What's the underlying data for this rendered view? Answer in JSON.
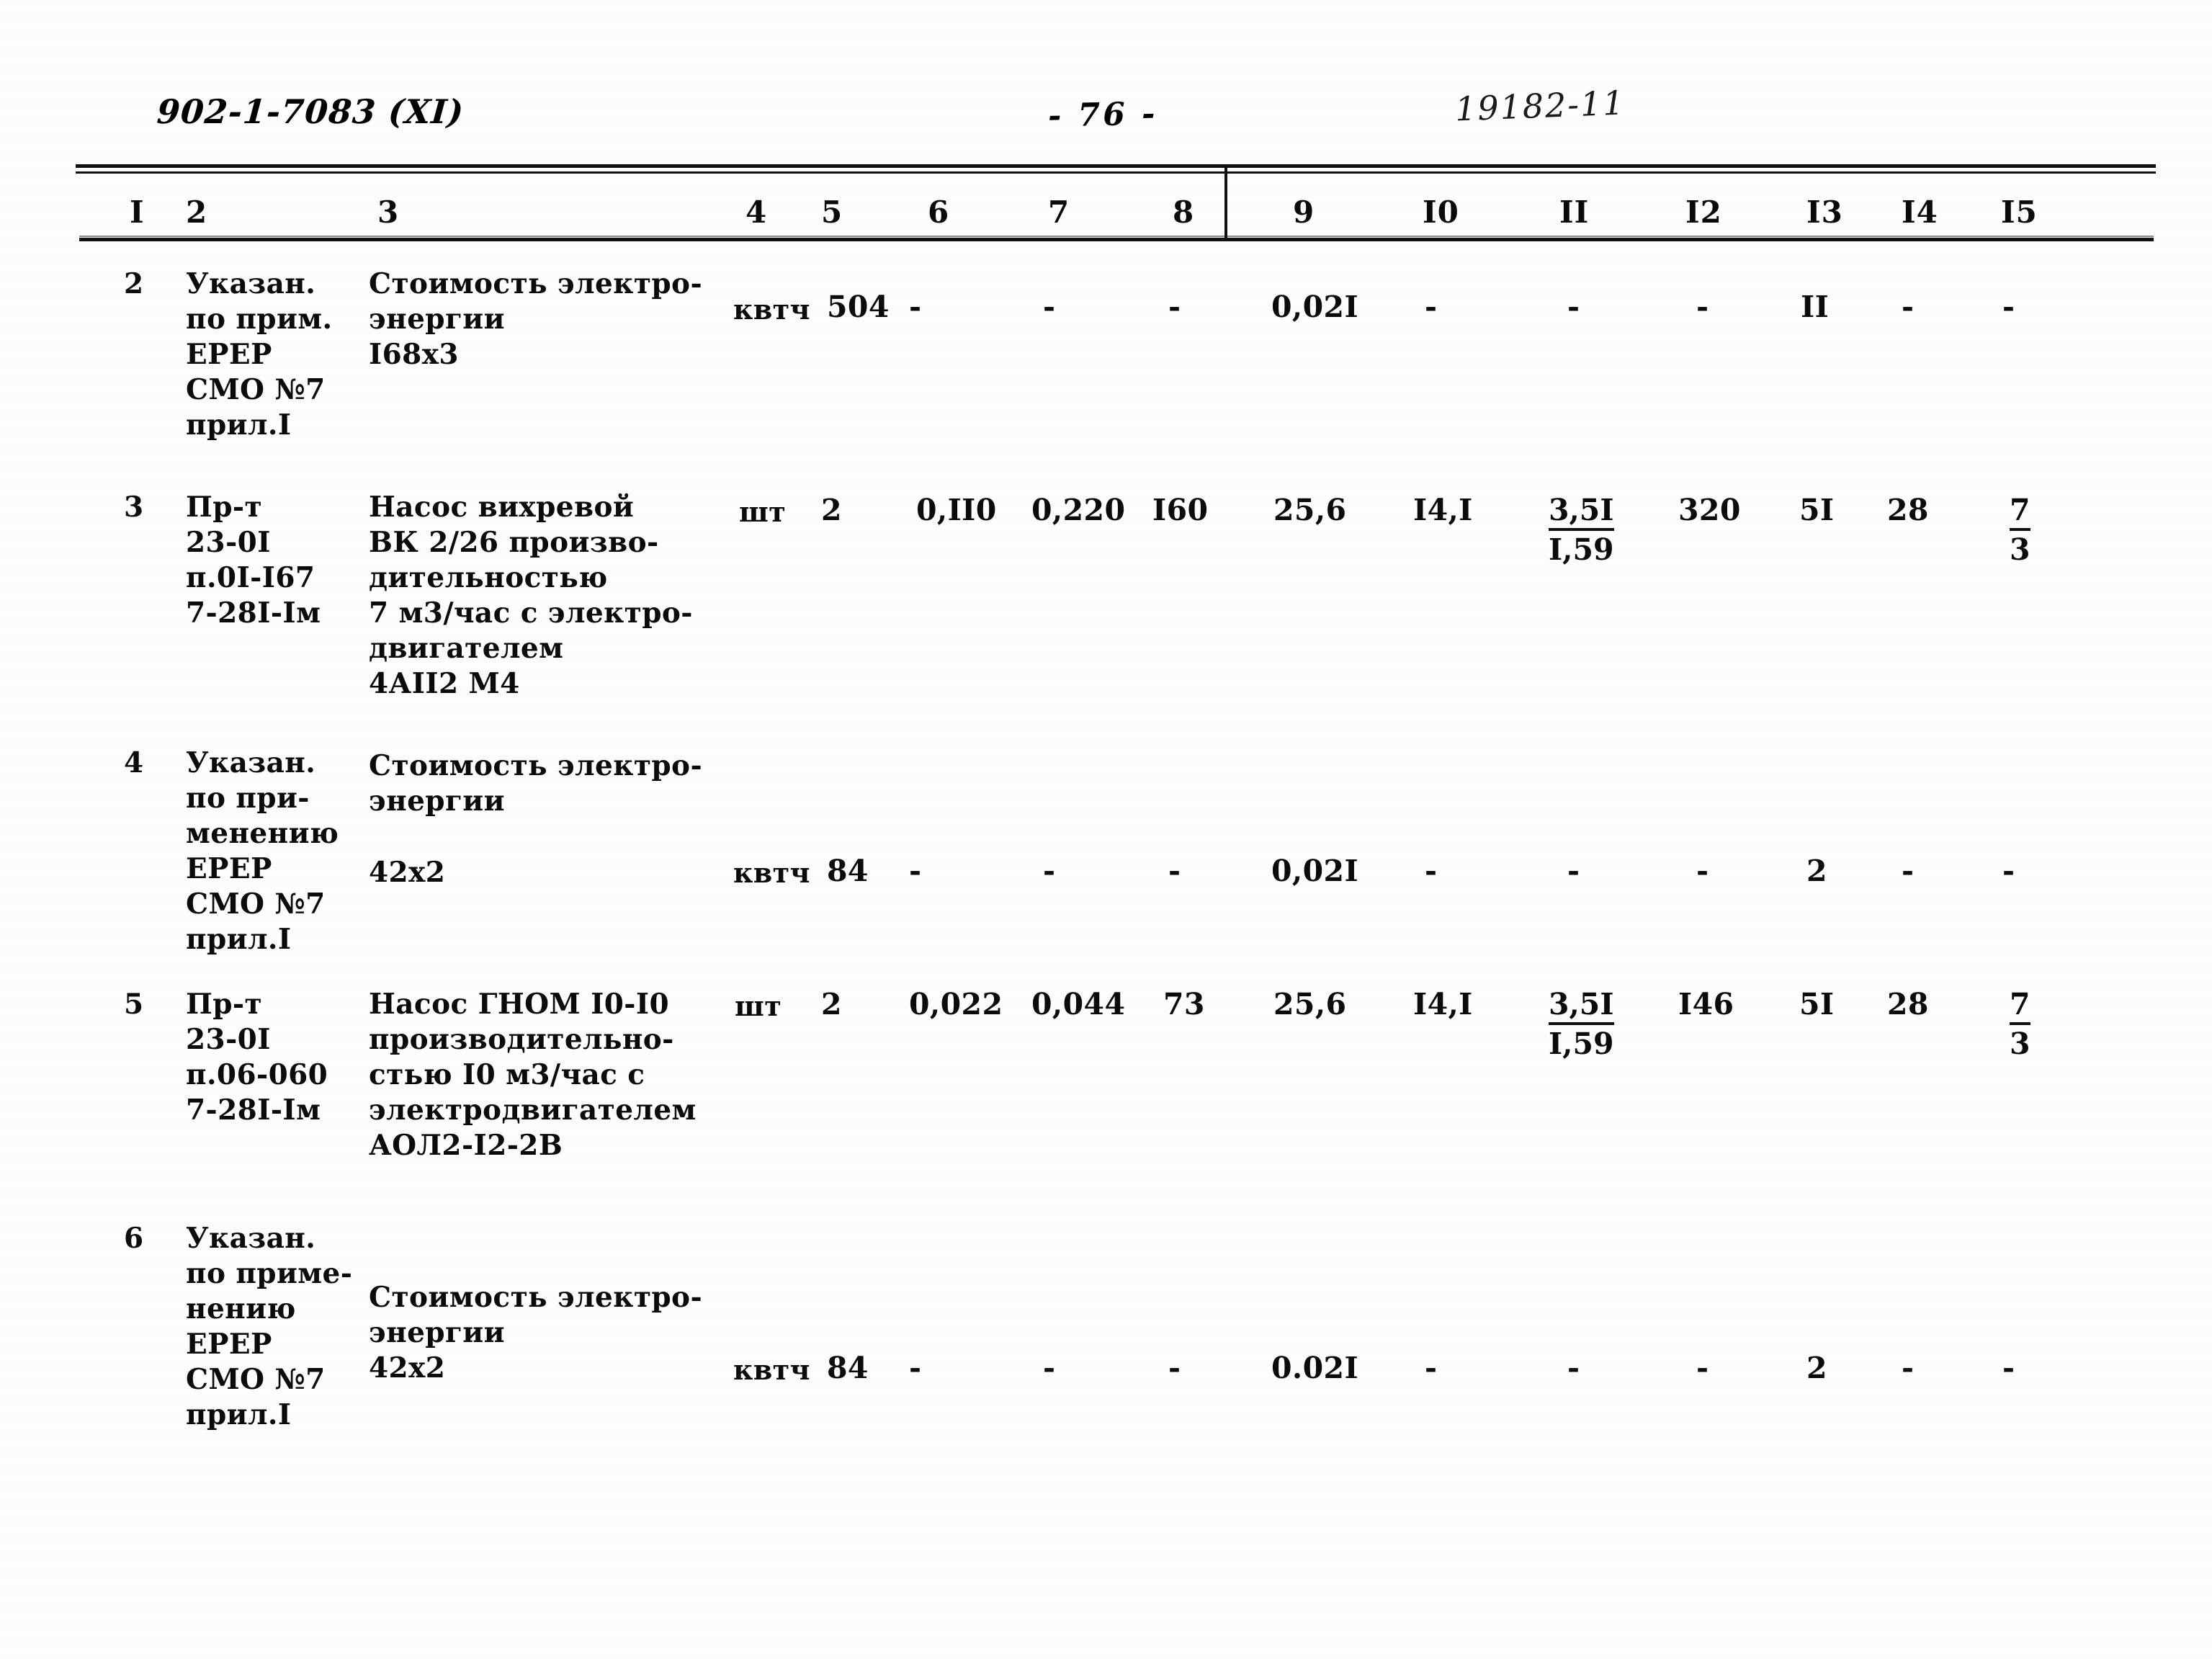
{
  "header": {
    "doc_id": "902-1-7083 (XI)",
    "page_number": "- 76 -",
    "stamp": "19182-11"
  },
  "table": {
    "column_headers": [
      "I",
      "2",
      "3",
      "4",
      "5",
      "6",
      "7",
      "8",
      "9",
      "I0",
      "II",
      "I2",
      "I3",
      "I4",
      "I5"
    ],
    "rows": [
      {
        "num": "2",
        "c2": "Указан.\nпо прим.\nЕРЕР\nСМО №7\nприл.I",
        "c3": "Стоимость электро-\nэнергии\nI68х3",
        "c4": "квтч",
        "c5": "504",
        "c6": "-",
        "c7": "-",
        "c8": "-",
        "c9": "0,02I",
        "c10": "-",
        "c11": "-",
        "c12": "-",
        "c13": "II",
        "c14": "-",
        "c15": "-"
      },
      {
        "num": "3",
        "c2": "Пр-т\n23-0I\nп.0I-I67\n7-28I-Iм",
        "c3": "Насос вихревой\nВК 2/26 произво-\nдительностью\n7 м3/час с электро-\nдвигателем\n4АII2 М4",
        "c4": "шт",
        "c5": "2",
        "c6": "0,II0",
        "c7": "0,220",
        "c8": "I60",
        "c9": "25,6",
        "c10": "I4,I",
        "c11_top": "3,5I",
        "c11_bot": "I,59",
        "c12": "320",
        "c13": "5I",
        "c14": "28",
        "c15_top": "7",
        "c15_bot": "3"
      },
      {
        "num": "4",
        "c2": "Указан.\nпо при-\nменению\nЕРЕР\nСМО №7\nприл.I",
        "c3_a": "Стоимость электро-\nэнергии",
        "c3_b": "42х2",
        "c4": "квтч",
        "c5": "84",
        "c6": "-",
        "c7": "-",
        "c8": "-",
        "c9": "0,02I",
        "c10": "-",
        "c11": "-",
        "c12": "-",
        "c13": "2",
        "c14": "-",
        "c15": "-"
      },
      {
        "num": "5",
        "c2": "Пр-т\n23-0I\nп.06-060\n7-28I-Iм",
        "c3": "Насос ГНОМ I0-I0\nпроизводительно-\nстью I0 м3/час с\nэлектродвигателем\nАОЛ2-I2-2В",
        "c4": "шт",
        "c5": "2",
        "c6": "0,022",
        "c7": "0,044",
        "c8": "73",
        "c9": "25,6",
        "c10": "I4,I",
        "c11_top": "3,5I",
        "c11_bot": "I,59",
        "c12": "I46",
        "c13": "5I",
        "c14": "28",
        "c15_top": "7",
        "c15_bot": "3"
      },
      {
        "num": "6",
        "c2": "Указан.\nпо приме-\nнению\nЕРЕР\nСМО №7\nприл.I",
        "c3_a": "Стоимость электро-\nэнергии",
        "c3_b": "42х2",
        "c4": "квтч",
        "c5": "84",
        "c6": "-",
        "c7": "-",
        "c8": "-",
        "c9": "0.02I",
        "c10": "-",
        "c11": "-",
        "c12": "-",
        "c13": "2",
        "c14": "-",
        "c15": "-"
      }
    ]
  }
}
